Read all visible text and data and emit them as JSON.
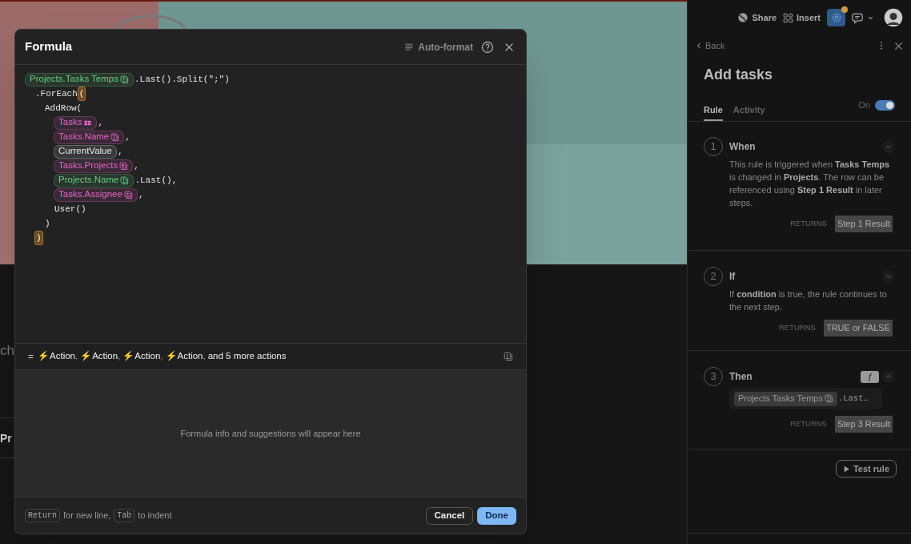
{
  "background": {
    "partial_texts": [
      "ch",
      "Pr"
    ]
  },
  "formula_dialog": {
    "title": "Formula",
    "auto_format": "Auto-format",
    "lines": [
      {
        "segments": [
          {
            "kind": "text-column",
            "color": "#62d083",
            "label": "Projects.Tasks Temps"
          },
          {
            "kind": "code",
            "text": ".Last().Split(\";\")"
          }
        ],
        "children": [
          {
            "segments": [
              {
                "kind": "code",
                "text": ".ForEach"
              },
              {
                "kind": "paren",
                "text": "(",
                "highlighted": true
              }
            ],
            "children": [
              {
                "segments": [
                  {
                    "kind": "code",
                    "text": "AddRow("
                  }
                ],
                "children": [
                  {
                    "segments": [
                      {
                        "kind": "table",
                        "color": "#e466c8",
                        "label": "Tasks"
                      },
                      {
                        "kind": "code",
                        "text": ","
                      }
                    ]
                  },
                  {
                    "segments": [
                      {
                        "kind": "text-column",
                        "color": "#e466c8",
                        "label": "Tasks.Name"
                      },
                      {
                        "kind": "code",
                        "text": ","
                      }
                    ]
                  },
                  {
                    "segments": [
                      {
                        "kind": "value",
                        "color": "#e6e6e6",
                        "label": "CurrentValue"
                      },
                      {
                        "kind": "code",
                        "text": ","
                      }
                    ]
                  },
                  {
                    "segments": [
                      {
                        "kind": "lookup-column",
                        "color": "#e466c8",
                        "label": "Tasks.Projects"
                      },
                      {
                        "kind": "code",
                        "text": ","
                      }
                    ]
                  },
                  {
                    "segments": [
                      {
                        "kind": "text-column",
                        "color": "#62d083",
                        "label": "Projects.Name"
                      },
                      {
                        "kind": "code",
                        "text": ".Last(),"
                      }
                    ]
                  },
                  {
                    "segments": [
                      {
                        "kind": "person-column",
                        "color": "#e466c8",
                        "label": "Tasks.Assignee"
                      },
                      {
                        "kind": "code",
                        "text": ","
                      }
                    ]
                  },
                  {
                    "segments": [
                      {
                        "kind": "code",
                        "text": "User()"
                      }
                    ]
                  }
                ]
              },
              {
                "segments": [
                  {
                    "kind": "code",
                    "text": ")"
                  }
                ]
              }
            ]
          },
          {
            "segments": [
              {
                "kind": "paren",
                "text": ")",
                "highlighted": true
              }
            ]
          }
        ]
      }
    ],
    "result": {
      "equals": "=",
      "items": [
        {
          "icon": "⚡",
          "label": "Action"
        },
        {
          "icon": "⚡",
          "label": "Action"
        },
        {
          "icon": "⚡",
          "label": "Action"
        },
        {
          "icon": "⚡",
          "label": "Action"
        }
      ],
      "separator": ",",
      "more": "and 5 more actions"
    },
    "info": "Formula info and suggestions will appear here",
    "hint": [
      {
        "key": "Return",
        "text": "for new line,"
      },
      {
        "key": "Tab",
        "text": "to indent"
      }
    ],
    "buttons": [
      {
        "label": "Cancel",
        "primary": false
      },
      {
        "label": "Done",
        "primary": true
      }
    ]
  },
  "toolbar": {
    "share": "Share",
    "insert": "Insert",
    "settings_badge": true
  },
  "rule_panel": {
    "back": "Back",
    "title": "Add tasks",
    "tabs": [
      {
        "label": "Rule",
        "selected": true
      },
      {
        "label": "Activity",
        "selected": false
      }
    ],
    "toggle": {
      "label": "On",
      "on": true
    },
    "steps": [
      {
        "number": "1",
        "title": "When",
        "expanded": false,
        "description": "This rule is triggered when **Tasks Temps** is changed in **Projects**. The row can be referenced using **Step 1 Result** in later steps.",
        "returns_label": "RETURNS",
        "returns": "Step 1 Result"
      },
      {
        "number": "2",
        "title": "If",
        "expanded": false,
        "description": "If **condition** is true, the rule continues to the next step.",
        "returns_label": "RETURNS",
        "returns": "TRUE or FALSE"
      },
      {
        "number": "3",
        "title": "Then",
        "expanded": true,
        "badge": "ƒ",
        "formula": {
          "label": "Projects Tasks Temps",
          "rest": ".Last…"
        },
        "returns_label": "RETURNS",
        "returns": "Step 3 Result"
      }
    ],
    "test_button": "Test rule"
  }
}
